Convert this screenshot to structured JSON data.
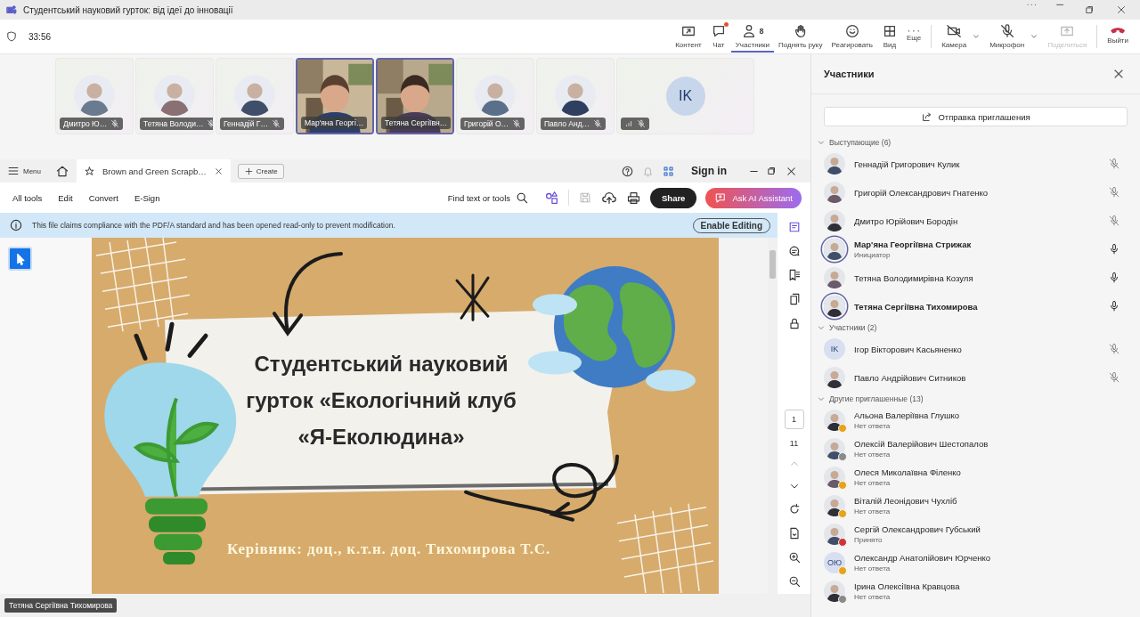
{
  "window": {
    "title": "Студентський науковий гурток: від ідеї до інновації"
  },
  "timer": "33:56",
  "toolbar": [
    {
      "label": "Контент",
      "kind": "action",
      "selected": false,
      "disabled": false,
      "notification": false
    },
    {
      "label": "Чат",
      "kind": "action",
      "selected": false,
      "disabled": false,
      "notification": true
    },
    {
      "label": "Участники",
      "count": "8",
      "kind": "action",
      "selected": true,
      "disabled": false,
      "notification": false
    },
    {
      "label": "Поднять руку",
      "kind": "action",
      "selected": false,
      "disabled": false,
      "notification": false
    },
    {
      "label": "Реагировать",
      "kind": "action",
      "selected": false,
      "disabled": false,
      "notification": false
    },
    {
      "label": "Вид",
      "kind": "action",
      "selected": false,
      "disabled": false,
      "notification": false
    },
    {
      "label": "Еще",
      "kind": "action",
      "selected": false,
      "disabled": false,
      "notification": false
    },
    {
      "label": "Камера",
      "kind": "device",
      "selected": false,
      "disabled": false,
      "notification": false
    },
    {
      "label": "Микрофон",
      "kind": "device",
      "selected": false,
      "disabled": false,
      "notification": false
    },
    {
      "label": "Поделиться",
      "kind": "share",
      "selected": false,
      "disabled": true,
      "notification": false
    },
    {
      "label": "Выйти",
      "kind": "leave",
      "selected": false,
      "disabled": false,
      "notification": false
    }
  ],
  "tiles": [
    {
      "kind": "avatar",
      "name": "Дмитро Ю…",
      "muted": true,
      "selected": false
    },
    {
      "kind": "avatar",
      "name": "Тетяна Володи…",
      "muted": true,
      "selected": false
    },
    {
      "kind": "avatar",
      "name": "Геннадій Г…",
      "muted": true,
      "selected": false
    },
    {
      "kind": "video",
      "name": "Мар'яна Георгі…",
      "muted": false,
      "selected": true
    },
    {
      "kind": "video",
      "name": "Тетяна Сергіївн…",
      "muted": false,
      "selected": true
    },
    {
      "kind": "avatar",
      "name": "Григорій О…",
      "muted": true,
      "selected": false
    },
    {
      "kind": "avatar",
      "name": "Павло Анд…",
      "muted": true,
      "selected": false
    },
    {
      "kind": "initials",
      "initials": "IK",
      "muted": true,
      "selected": false
    }
  ],
  "pdf_viewer": {
    "menu": "Menu",
    "tab": "Brown and Green Scrapb…",
    "create": "Create",
    "sign_in": "Sign in",
    "tools": [
      "All tools",
      "Edit",
      "Convert",
      "E-Sign"
    ],
    "find": "Find text or tools",
    "share": "Share",
    "ai_assistant": "Ask AI Assistant",
    "notice": "This file claims compliance with the PDF/A standard and has been opened read-only to prevent modification.",
    "enable_editing": "Enable Editing",
    "page_number": "1",
    "page_count": "11",
    "slide": {
      "title_lines": [
        "Студентський науковий",
        "гурток «Екологічний клуб",
        "«Я-Еколюдина»"
      ],
      "footer": "Керівник: доц., к.т.н. доц. Тихомирова Т.С."
    }
  },
  "speaker_caption": "Тетяна Сергіївна Тихомирова",
  "participants_panel": {
    "title": "Участники",
    "invite_button": "Отправка приглашения",
    "sections": [
      {
        "title": "Выступающие (6)",
        "expanded": true,
        "people": [
          {
            "name": "Геннадій Григорович Кулик",
            "muted": true,
            "highlighted": false
          },
          {
            "name": "Григорій Олександрович Гнатенко",
            "muted": true,
            "highlighted": false
          },
          {
            "name": "Дмитро Юрійович Бородін",
            "muted": true,
            "highlighted": false
          },
          {
            "name": "Мар'яна Георгіївна Стрижак",
            "subtitle": "Инициатор",
            "muted": false,
            "highlighted": true
          },
          {
            "name": "Тетяна Володимирівна Козуля",
            "muted": false,
            "highlighted": false
          },
          {
            "name": "Тетяна Сергіївна Тихомирова",
            "muted": false,
            "highlighted": true
          }
        ]
      },
      {
        "title": "Участники (2)",
        "expanded": true,
        "people": [
          {
            "name": "Ігор Вікторович Касьяненко",
            "kind": "initials",
            "initials": "IK",
            "muted": true,
            "highlighted": false
          },
          {
            "name": "Павло Андрійович Ситников",
            "muted": true,
            "highlighted": false
          }
        ]
      },
      {
        "title": "Другие приглашенные (13)",
        "expanded": true,
        "people": [
          {
            "name": "Альона Валеріївна Глушко",
            "subtitle": "Нет ответа",
            "highlighted": false,
            "color": "#e8a317"
          },
          {
            "name": "Олексій Валерійович Шестопалов",
            "subtitle": "Нет ответа",
            "highlighted": false,
            "color": "#8a8a8a"
          },
          {
            "name": "Олеся Миколаївна Філенко",
            "subtitle": "Нет ответа",
            "highlighted": false,
            "color": "#e8a317"
          },
          {
            "name": "Віталій Леонідович Чухліб",
            "subtitle": "Нет ответа",
            "highlighted": false,
            "color": "#e8a317"
          },
          {
            "name": "Сергій Олександрович Губський",
            "subtitle": "Принято",
            "highlighted": false,
            "color": "#d13438"
          },
          {
            "name": "Олександр Анатолійович Юрченко",
            "subtitle": "Нет ответа",
            "kind": "initials",
            "initials": "ОЮ",
            "highlighted": false,
            "color": "#e8a317"
          },
          {
            "name": "Ірина Олексіївна Кравцова",
            "subtitle": "Нет ответа",
            "highlighted": false,
            "color": "#8a8a8a"
          }
        ]
      }
    ]
  }
}
